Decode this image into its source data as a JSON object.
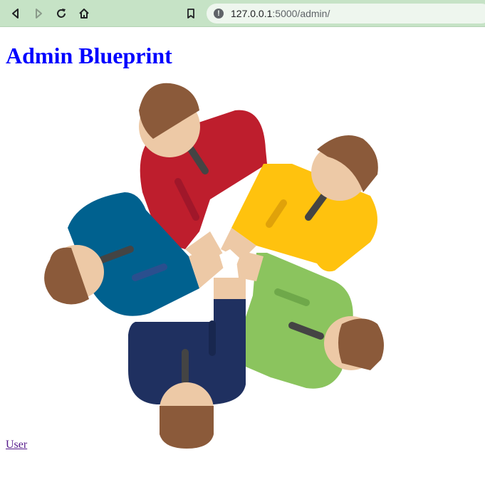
{
  "browser": {
    "url_host": "127.0.0.1",
    "url_rest": ":5000/admin/",
    "icons": {
      "back": "arrow-left-icon",
      "forward": "arrow-right-icon",
      "reload": "reload-icon",
      "home": "home-icon",
      "bookmark": "bookmark-icon",
      "site_info": "info-icon"
    }
  },
  "page": {
    "title": "Admin Blueprint",
    "title_color": "#0000ff",
    "link_label": "User",
    "illustration": "teamwork-hands-icon",
    "colors": {
      "red": "#be1e2d",
      "yellow": "#ffc20e",
      "blue": "#00618f",
      "green": "#8bc45e",
      "navy": "#1f3060",
      "hair": "#8b5a3a",
      "skin": "#edc9a6",
      "tie": "#444444"
    }
  }
}
